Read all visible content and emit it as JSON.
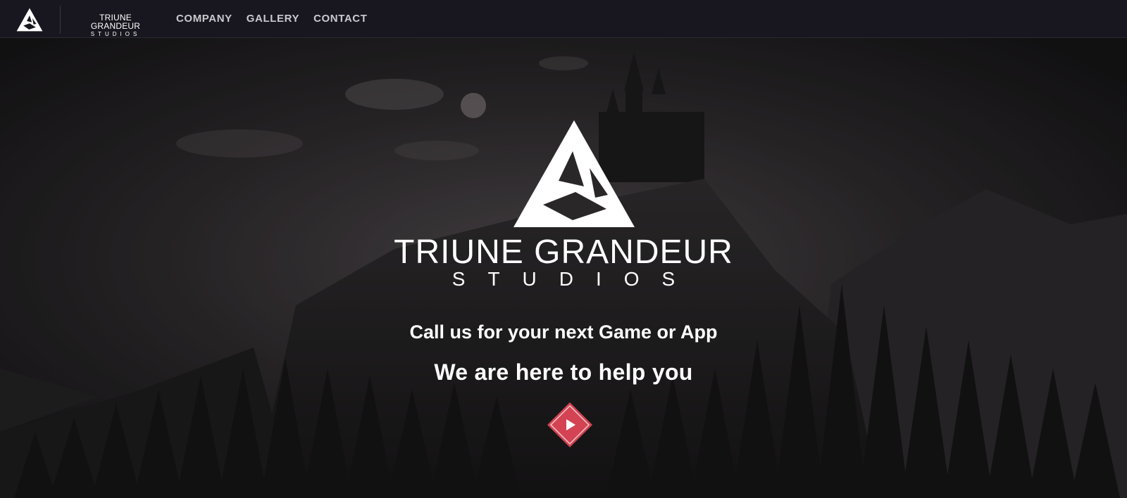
{
  "nav": {
    "brand_line1": "TRIUNE GRANDEUR",
    "brand_line2": "STUDIOS",
    "links": [
      {
        "label": "COMPANY"
      },
      {
        "label": "GALLERY"
      },
      {
        "label": "CONTACT"
      }
    ]
  },
  "hero": {
    "title": "TRIUNE GRANDEUR",
    "subtitle": "STUDIOS",
    "tagline1": "Call us for your next Game or App",
    "tagline2": "We are here to help you",
    "play_icon": "play-icon"
  },
  "colors": {
    "navbar_bg": "#18171f",
    "play_accent": "#e8485a",
    "text": "#ffffff"
  }
}
